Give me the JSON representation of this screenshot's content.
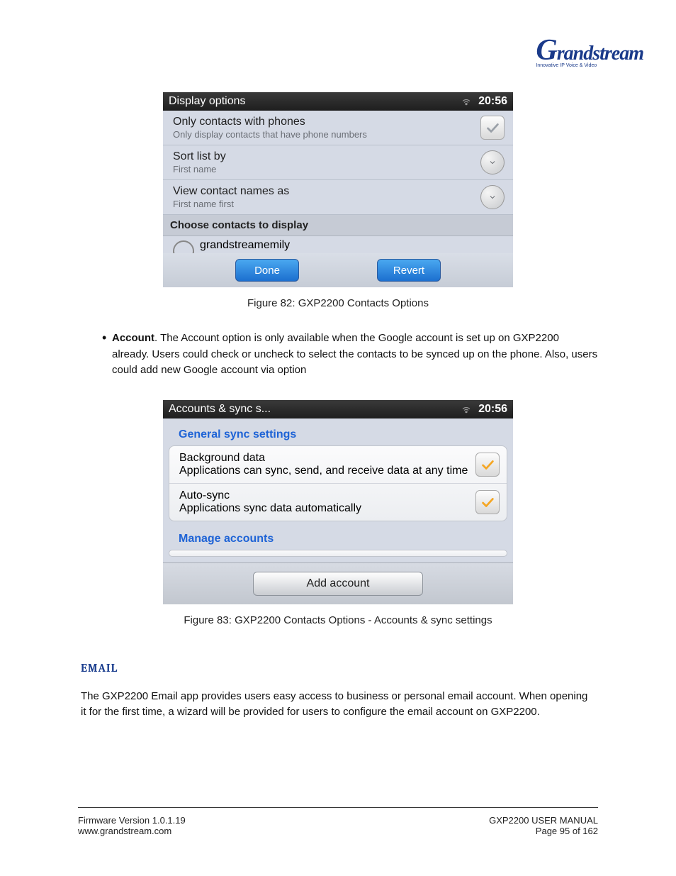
{
  "logo": {
    "brand": "Grandstream",
    "tagline": "Innovative IP Voice & Video"
  },
  "screenshot1": {
    "title": "Display options",
    "time": "20:56",
    "rows": [
      {
        "title": "Only contacts with phones",
        "sub": "Only display contacts that have phone numbers",
        "control": "check-gray"
      },
      {
        "title": "Sort list by",
        "sub": "First name",
        "control": "spinner"
      },
      {
        "title": "View contact names as",
        "sub": "First name first",
        "control": "spinner"
      }
    ],
    "section": "Choose contacts to display",
    "account": "grandstreamemily",
    "done": "Done",
    "revert": "Revert"
  },
  "caption1": "Figure 82: GXP2200 Contacts Options",
  "bullet": {
    "lead": "Account",
    "text": ". The Account option is only available when the Google account is set up on GXP2200 already. Users could check or uncheck to select the contacts to be synced up on the phone. Also, users could add new Google account via option"
  },
  "screenshot2": {
    "title": "Accounts & sync s...",
    "time": "20:56",
    "header1": "General sync settings",
    "rows": [
      {
        "title": "Background data",
        "sub": "Applications can sync, send, and receive data at any time"
      },
      {
        "title": "Auto-sync",
        "sub": "Applications sync data automatically"
      }
    ],
    "header2": "Manage accounts",
    "add_btn": "Add account"
  },
  "caption2": "Figure 83: GXP2200 Contacts Options - Accounts & sync settings",
  "email_head": "EMAIL",
  "email_para": "The GXP2200 Email app provides users easy access to business or personal email account. When opening it for the first time, a wizard will be provided for users to configure the email account on GXP2200.",
  "footer": {
    "left_l1": "Firmware Version 1.0.1.19",
    "left_l2": "www.grandstream.com",
    "right_l1": "GXP2200 USER MANUAL",
    "right_l2": "Page 95 of 162"
  }
}
